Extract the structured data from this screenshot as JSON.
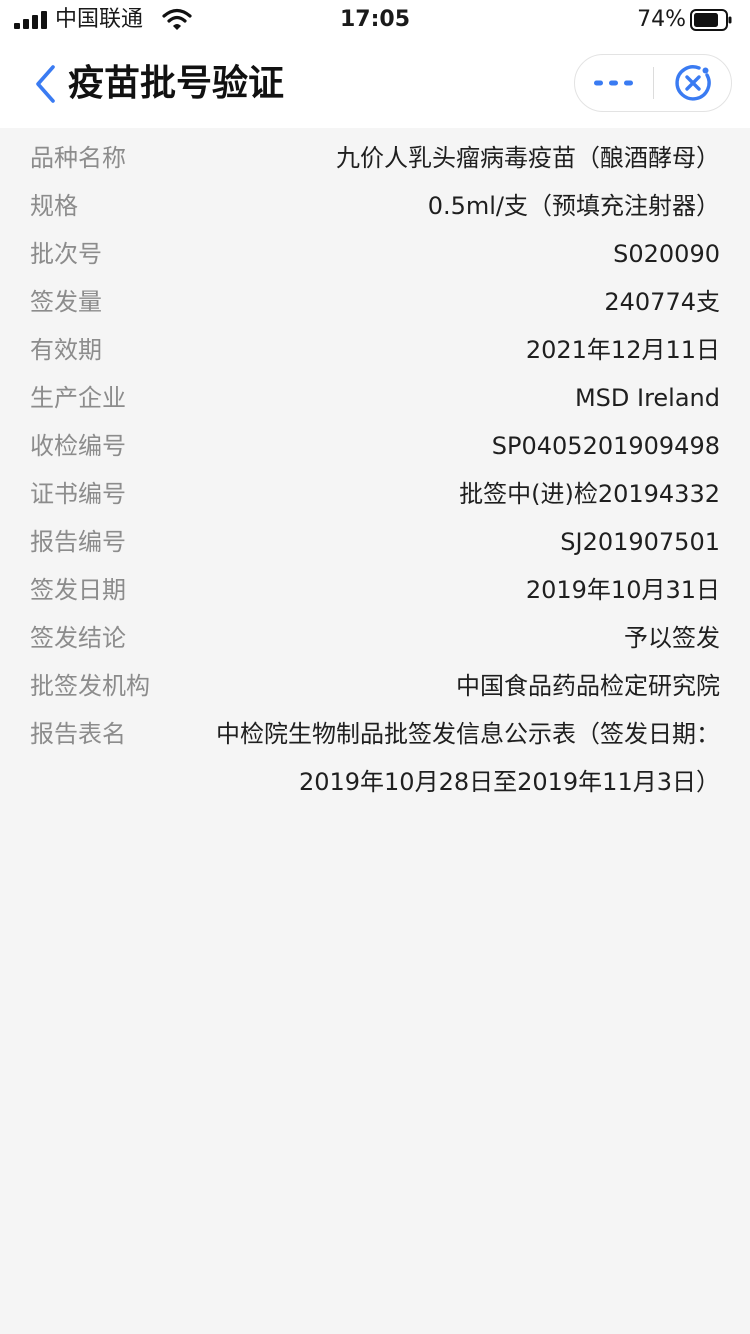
{
  "status_bar": {
    "carrier": "中国联通",
    "time": "17:05",
    "battery": "74%"
  },
  "nav": {
    "title": "疫苗批号验证",
    "icons": {
      "back": "chevron-left-icon",
      "more": "more-dots-icon",
      "close": "close-circle-icon"
    },
    "accent_color": "#3a7bf2"
  },
  "details": [
    {
      "label": "品种名称",
      "value": "九价人乳头瘤病毒疫苗（酿酒酵母）"
    },
    {
      "label": "规格",
      "value": "0.5ml/支（预填充注射器）"
    },
    {
      "label": "批次号",
      "value": "S020090"
    },
    {
      "label": "签发量",
      "value": "240774支"
    },
    {
      "label": "有效期",
      "value": "2021年12月11日"
    },
    {
      "label": "生产企业",
      "value": "MSD Ireland"
    },
    {
      "label": "收检编号",
      "value": "SP0405201909498"
    },
    {
      "label": "证书编号",
      "value": "批签中(进)检20194332"
    },
    {
      "label": "报告编号",
      "value": "SJ201907501"
    },
    {
      "label": "签发日期",
      "value": "2019年10月31日"
    },
    {
      "label": "签发结论",
      "value": "予以签发"
    },
    {
      "label": "批签发机构",
      "value": "中国食品药品检定研究院"
    },
    {
      "label": "报告表名",
      "value": "中检院生物制品批签发信息公示表（签发日期：2019年10月28日至2019年11月3日）"
    }
  ]
}
